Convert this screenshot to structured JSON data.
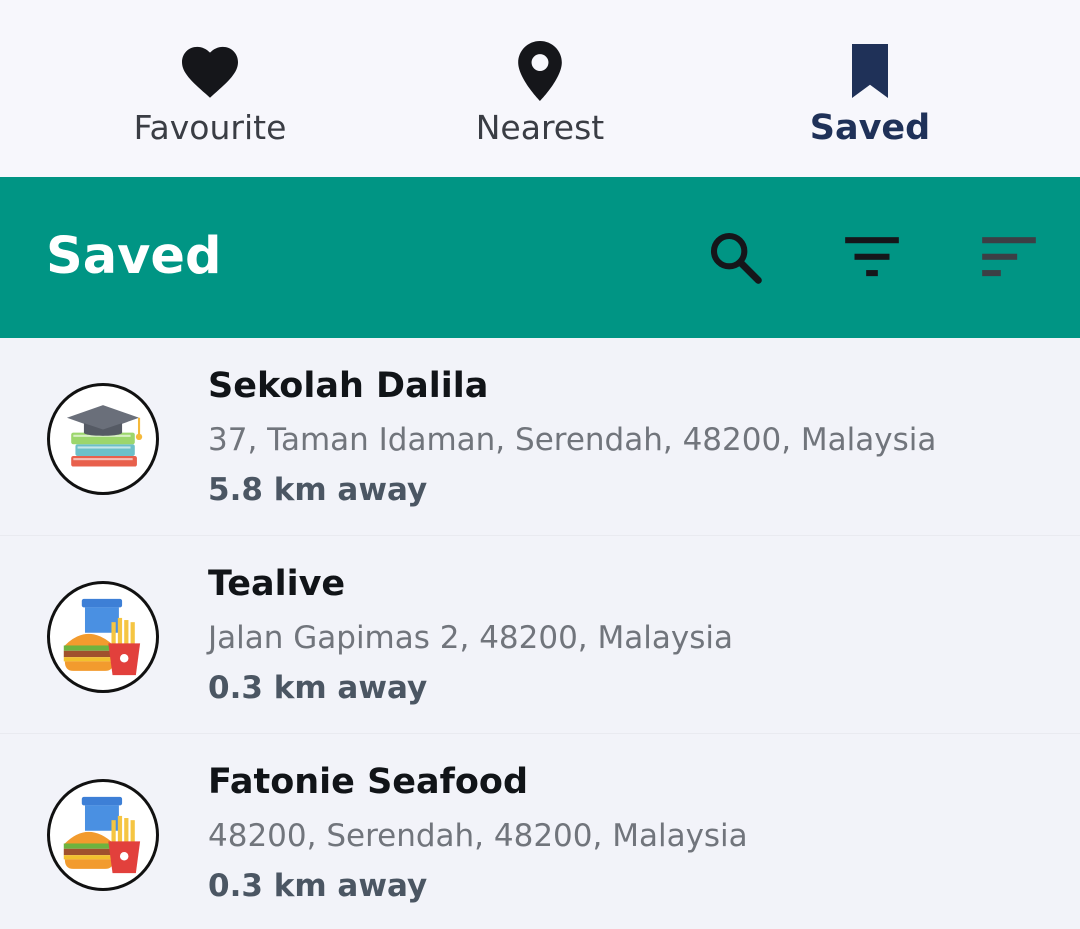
{
  "tabs": {
    "favourite": {
      "label": "Favourite",
      "icon": "heart-icon"
    },
    "nearest": {
      "label": "Nearest",
      "icon": "map-pin-icon"
    },
    "saved": {
      "label": "Saved",
      "icon": "bookmark-icon"
    },
    "active": "saved"
  },
  "header": {
    "title": "Saved",
    "actions": [
      "search-icon",
      "filter-icon",
      "sort-icon"
    ]
  },
  "colors": {
    "header_bg": "#009584",
    "active_tab": "#1f3158",
    "list_bg": "#f2f3f9"
  },
  "places": [
    {
      "name": "Sekolah Dalila",
      "address": "37, Taman Idaman, Serendah, 48200, Malaysia",
      "distance": "5.8 km away",
      "icon": "school-icon"
    },
    {
      "name": "Tealive",
      "address": "Jalan Gapimas 2, 48200, Malaysia",
      "distance": "0.3 km away",
      "icon": "fast-food-icon"
    },
    {
      "name": "Fatonie Seafood",
      "address": "48200, Serendah, 48200, Malaysia",
      "distance": "0.3 km away",
      "icon": "fast-food-icon"
    }
  ]
}
